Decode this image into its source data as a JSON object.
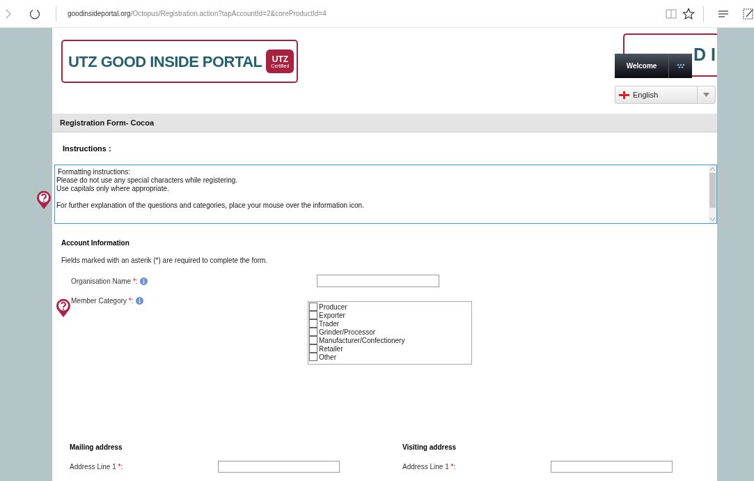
{
  "browser": {
    "url_domain": "goodinsideportal.org",
    "url_path": "/Octopus/Registration.action?tapAccountId=2&coreProductId=4"
  },
  "header": {
    "logo_text": "UTZ GOOD INSIDE PORTAL",
    "badge_text": "UTZ",
    "badge_subtext": "Certified",
    "second_logo_text": "D I",
    "user_menu": "Welcome",
    "language": "English"
  },
  "form": {
    "title": "Registration Form- Cocoa",
    "instructions_label": "Instructions :",
    "instructions": [
      "Formatting instructions:",
      "Please do not use any special characters while registering.",
      "Use capitals only where appropriate."
    ],
    "instructions_note": "For further explanation of the questions and categories, place your mouse over the information icon.",
    "account_heading": "Account Information",
    "required_note": "Fields marked with an asterik (*) are required to complete the form.",
    "organisation_label": "Organisation Name",
    "member_label": "Member Category",
    "required_mark": "*",
    "label_suffix": ":",
    "categories": [
      {
        "label": "Producer",
        "checked": false
      },
      {
        "label": "Exporter",
        "checked": false
      },
      {
        "label": "Trader",
        "checked": false
      },
      {
        "label": "Grinder/Processor",
        "checked": false
      },
      {
        "label": "Manufacturer/Confectionery",
        "checked": false
      },
      {
        "label": "Retailer",
        "checked": false
      },
      {
        "label": "Other",
        "checked": false
      }
    ],
    "addresses": [
      {
        "heading": "Mailing address",
        "line_label": "Address Line 1"
      },
      {
        "heading": "Visiting address",
        "line_label": "Address Line 1"
      }
    ]
  }
}
